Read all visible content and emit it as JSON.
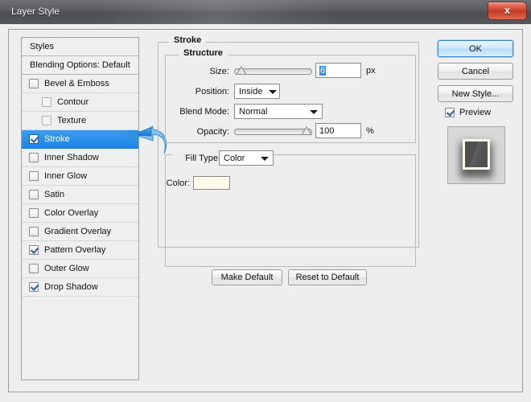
{
  "window": {
    "title": "Layer Style",
    "close_glyph": "x"
  },
  "styles_panel": {
    "header_styles": "Styles",
    "header_blending": "Blending Options: Default",
    "items": [
      {
        "label": "Bevel & Emboss",
        "checked": false,
        "indent": false,
        "selected": false,
        "dim": false
      },
      {
        "label": "Contour",
        "checked": false,
        "indent": true,
        "selected": false,
        "dim": true
      },
      {
        "label": "Texture",
        "checked": false,
        "indent": true,
        "selected": false,
        "dim": true
      },
      {
        "label": "Stroke",
        "checked": true,
        "indent": false,
        "selected": true,
        "dim": false
      },
      {
        "label": "Inner Shadow",
        "checked": false,
        "indent": false,
        "selected": false,
        "dim": false
      },
      {
        "label": "Inner Glow",
        "checked": false,
        "indent": false,
        "selected": false,
        "dim": false
      },
      {
        "label": "Satin",
        "checked": false,
        "indent": false,
        "selected": false,
        "dim": false
      },
      {
        "label": "Color Overlay",
        "checked": false,
        "indent": false,
        "selected": false,
        "dim": false
      },
      {
        "label": "Gradient Overlay",
        "checked": false,
        "indent": false,
        "selected": false,
        "dim": false
      },
      {
        "label": "Pattern Overlay",
        "checked": true,
        "indent": false,
        "selected": false,
        "dim": false
      },
      {
        "label": "Outer Glow",
        "checked": false,
        "indent": false,
        "selected": false,
        "dim": false
      },
      {
        "label": "Drop Shadow",
        "checked": true,
        "indent": false,
        "selected": false,
        "dim": false
      }
    ]
  },
  "stroke": {
    "group_legend": "Stroke",
    "structure_legend": "Structure",
    "size_label": "Size:",
    "size_value": "6",
    "size_unit": "px",
    "size_slider_percent": 2,
    "position_label": "Position:",
    "position_value": "Inside",
    "blend_mode_label": "Blend Mode:",
    "blend_mode_value": "Normal",
    "opacity_label": "Opacity:",
    "opacity_value": "100",
    "opacity_unit": "%",
    "opacity_slider_percent": 100
  },
  "fill": {
    "fill_type_label": "Fill Type:",
    "fill_type_value": "Color",
    "color_label": "Color:",
    "color_value": "#fdf8e8"
  },
  "actions": {
    "make_default": "Make Default",
    "reset_to_default": "Reset to Default"
  },
  "side_buttons": {
    "ok": "OK",
    "cancel": "Cancel",
    "new_style": "New Style...",
    "preview_label": "Preview",
    "preview_checked": true
  }
}
